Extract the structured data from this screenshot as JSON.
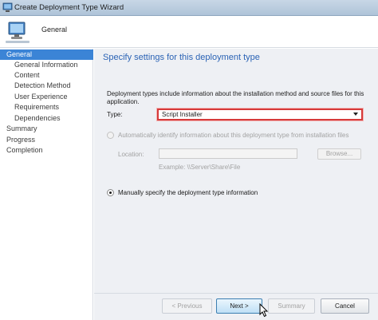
{
  "window": {
    "title": "Create Deployment Type Wizard",
    "icon": "computer-icon"
  },
  "header": {
    "title": "General",
    "icon": "computer-network-icon"
  },
  "nav": {
    "items": [
      {
        "label": "General",
        "level": "top",
        "active": true
      },
      {
        "label": "General Information",
        "level": "sub",
        "active": false
      },
      {
        "label": "Content",
        "level": "sub",
        "active": false
      },
      {
        "label": "Detection Method",
        "level": "sub",
        "active": false
      },
      {
        "label": "User Experience",
        "level": "sub",
        "active": false
      },
      {
        "label": "Requirements",
        "level": "sub",
        "active": false
      },
      {
        "label": "Dependencies",
        "level": "sub",
        "active": false
      },
      {
        "label": "Summary",
        "level": "top",
        "active": false
      },
      {
        "label": "Progress",
        "level": "top",
        "active": false
      },
      {
        "label": "Completion",
        "level": "top",
        "active": false
      }
    ]
  },
  "main": {
    "heading": "Specify settings for this deployment type",
    "intro": "Deployment types include information about the installation method and source files for this application.",
    "type_label": "Type:",
    "type_value": "Script Installer",
    "auto_option": "Automatically identify information about this deployment type from installation files",
    "location_label": "Location:",
    "location_value": "",
    "browse_label": "Browse...",
    "example": "Example: \\\\Server\\Share\\File",
    "manual_option": "Manually specify the deployment type information"
  },
  "footer": {
    "previous": "< Previous",
    "next": "Next >",
    "summary": "Summary",
    "cancel": "Cancel"
  },
  "colors": {
    "accent": "#3b84d6",
    "heading": "#2b63b5",
    "highlight_box": "#d63a3a"
  }
}
